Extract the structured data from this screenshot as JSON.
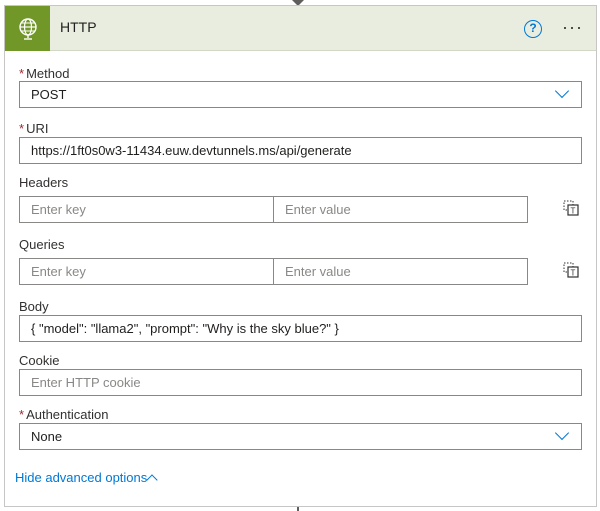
{
  "header": {
    "title": "HTTP",
    "icon": "globe-icon",
    "help_icon": "?",
    "more_icon": "···",
    "accent_color": "#709727"
  },
  "method": {
    "label": "Method",
    "required_mark": "*",
    "value": "POST"
  },
  "uri": {
    "label": "URI",
    "required_mark": "*",
    "value": "https://1ft0s0w3-11434.euw.devtunnels.ms/api/generate"
  },
  "headers": {
    "label": "Headers",
    "key_placeholder": "Enter key",
    "value_placeholder": "Enter value"
  },
  "queries": {
    "label": "Queries",
    "key_placeholder": "Enter key",
    "value_placeholder": "Enter value"
  },
  "body": {
    "label": "Body",
    "value": "{ \"model\": \"llama2\", \"prompt\": \"Why is the sky blue?\" }"
  },
  "cookie": {
    "label": "Cookie",
    "placeholder": "Enter HTTP cookie"
  },
  "authentication": {
    "label": "Authentication",
    "required_mark": "*",
    "value": "None"
  },
  "advanced": {
    "link_label": "Hide advanced options"
  }
}
